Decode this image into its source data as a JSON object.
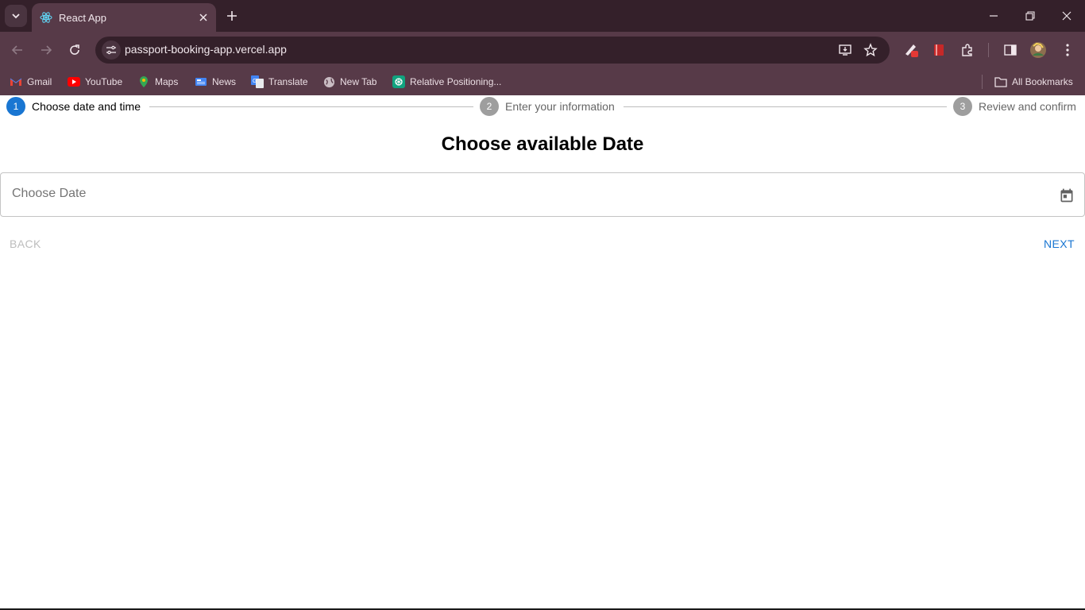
{
  "browser": {
    "tab": {
      "title": "React App",
      "favicon": "react-icon"
    },
    "address": {
      "url": "passport-booking-app.vercel.app"
    },
    "bookmarks": [
      {
        "label": "Gmail",
        "icon": "gmail-icon"
      },
      {
        "label": "YouTube",
        "icon": "youtube-icon"
      },
      {
        "label": "Maps",
        "icon": "maps-icon"
      },
      {
        "label": "News",
        "icon": "news-icon"
      },
      {
        "label": "Translate",
        "icon": "translate-icon"
      },
      {
        "label": "New Tab",
        "icon": "globe-icon"
      },
      {
        "label": "Relative Positioning...",
        "icon": "chatgpt-icon"
      }
    ],
    "all_bookmarks": "All Bookmarks"
  },
  "stepper": {
    "steps": [
      {
        "number": "1",
        "label": "Choose date and time",
        "active": true
      },
      {
        "number": "2",
        "label": "Enter your information",
        "active": false
      },
      {
        "number": "3",
        "label": "Review and confirm",
        "active": false
      }
    ]
  },
  "main": {
    "heading": "Choose available Date",
    "date_placeholder": "Choose Date",
    "back_label": "Back",
    "next_label": "Next"
  },
  "colors": {
    "primary": "#1976d2",
    "inactive_step": "#9e9e9e",
    "disabled_text": "#bdbdbd",
    "chrome_dark": "#34202a",
    "chrome_mid": "#573a48"
  }
}
